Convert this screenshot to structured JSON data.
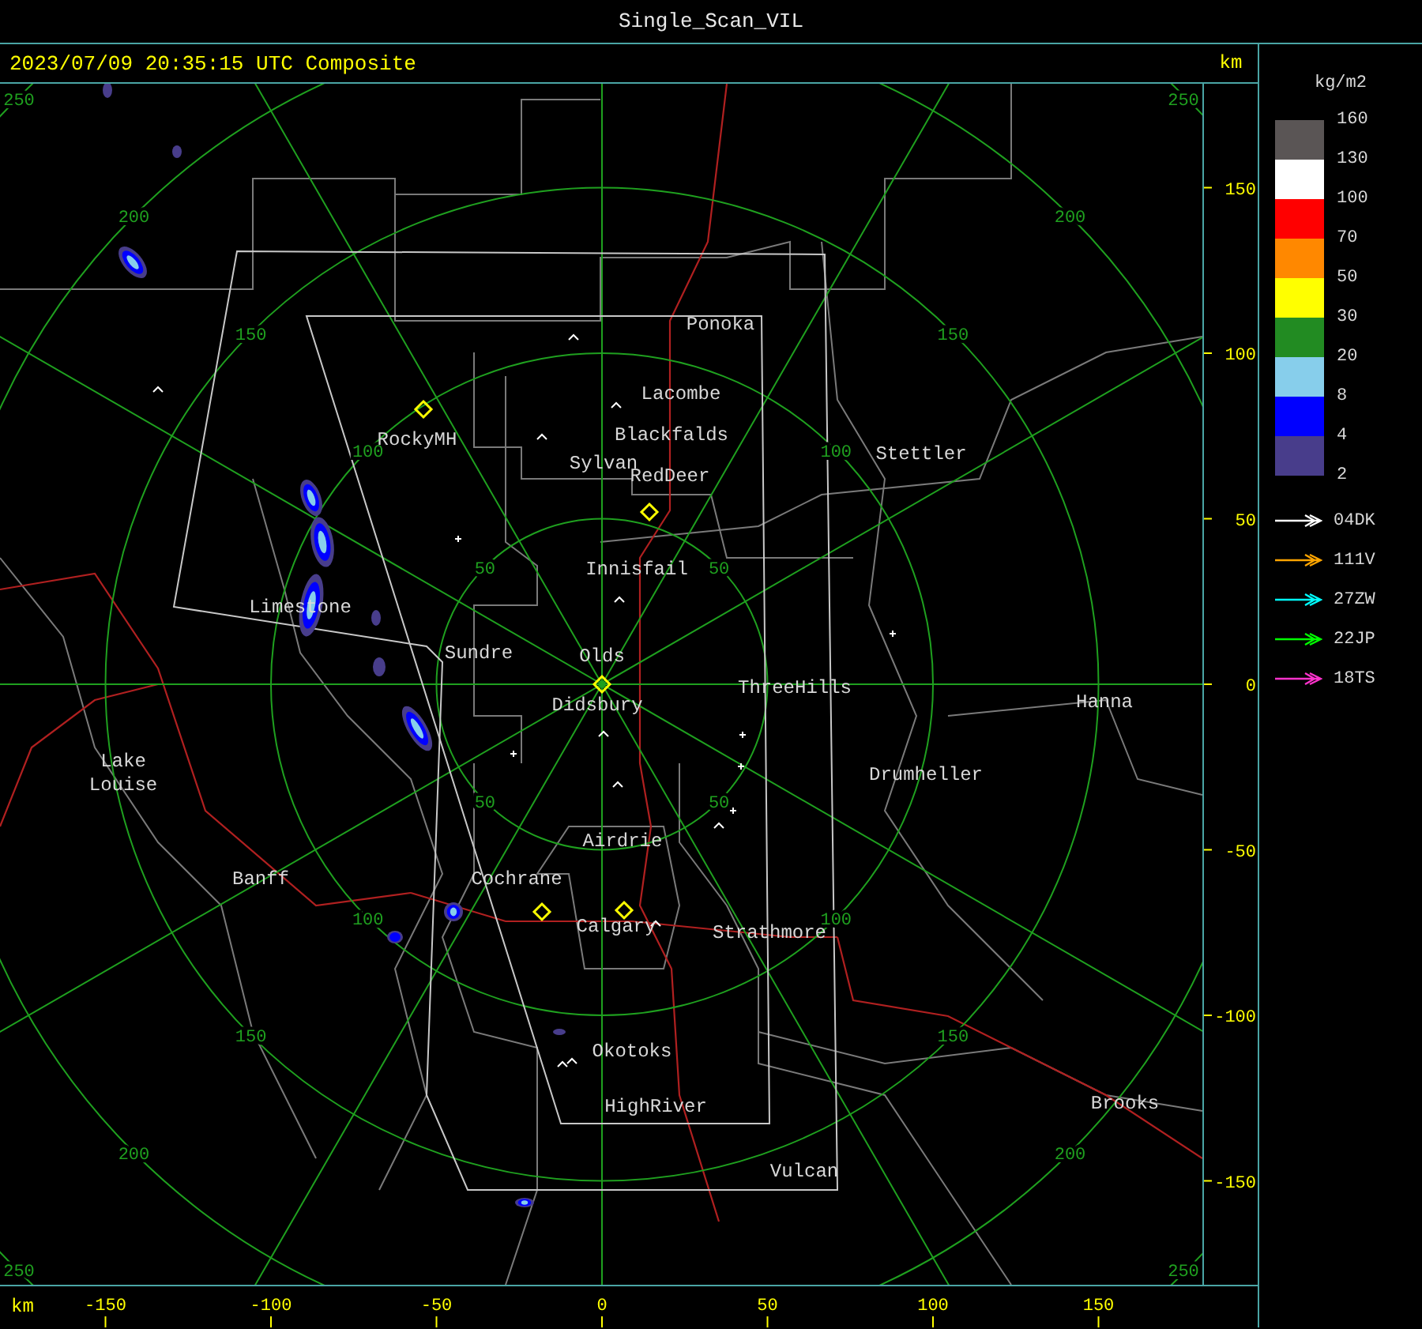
{
  "window": {
    "title": "Single_Scan_VIL"
  },
  "map": {
    "timestamp": "2023/07/09 20:35:15 UTC Composite",
    "unit_top": "km",
    "unit_bottom": "km",
    "x_ticks": [
      "-150",
      "-100",
      "-50",
      "0",
      "50",
      "100",
      "150"
    ],
    "y_ticks": [
      "150",
      "100",
      "50",
      "0",
      "-50",
      "-100",
      "-150"
    ],
    "range_labels": [
      "50",
      "100",
      "150",
      "200",
      "250",
      "50",
      "100",
      "150",
      "200",
      "250",
      "50",
      "100",
      "150",
      "200",
      "250",
      "50",
      "100",
      "150",
      "200",
      "250"
    ],
    "places": [
      "Ponoka",
      "Lacombe",
      "Blackfalds",
      "Sylvan",
      "RedDeer",
      "Stettler",
      "RockyMH",
      "Innisfail",
      "Limestone",
      "Sundre",
      "Olds",
      "Didsbury",
      "ThreeHills",
      "Hanna",
      "Lake Louise",
      "Drumheller",
      "Airdrie",
      "Banff",
      "Cochrane",
      "Calgary",
      "Strathmore",
      "Okotoks",
      "HighRiver",
      "Brooks",
      "Vulcan"
    ]
  },
  "legend": {
    "unit": "kg/m2",
    "scale_labels": [
      "160",
      "130",
      "100",
      "70",
      "50",
      "30",
      "20",
      "8",
      "4",
      "2"
    ],
    "scale_bins": [
      {
        "color": "#5a5555"
      },
      {
        "color": "#ffffff"
      },
      {
        "color": "#ff0000"
      },
      {
        "color": "#ff8800"
      },
      {
        "color": "#ffff00"
      },
      {
        "color": "#228b22"
      },
      {
        "color": "#87ceeb"
      },
      {
        "color": "#0000ff"
      },
      {
        "color": "#483d8b"
      }
    ],
    "tracks": [
      {
        "label": "04DK",
        "color": "#ffffff"
      },
      {
        "label": "111V",
        "color": "#ffa500"
      },
      {
        "label": "27ZW",
        "color": "#00ffff"
      },
      {
        "label": "22JP",
        "color": "#00ff00"
      },
      {
        "label": "18TS",
        "color": "#ff33cc"
      }
    ]
  }
}
